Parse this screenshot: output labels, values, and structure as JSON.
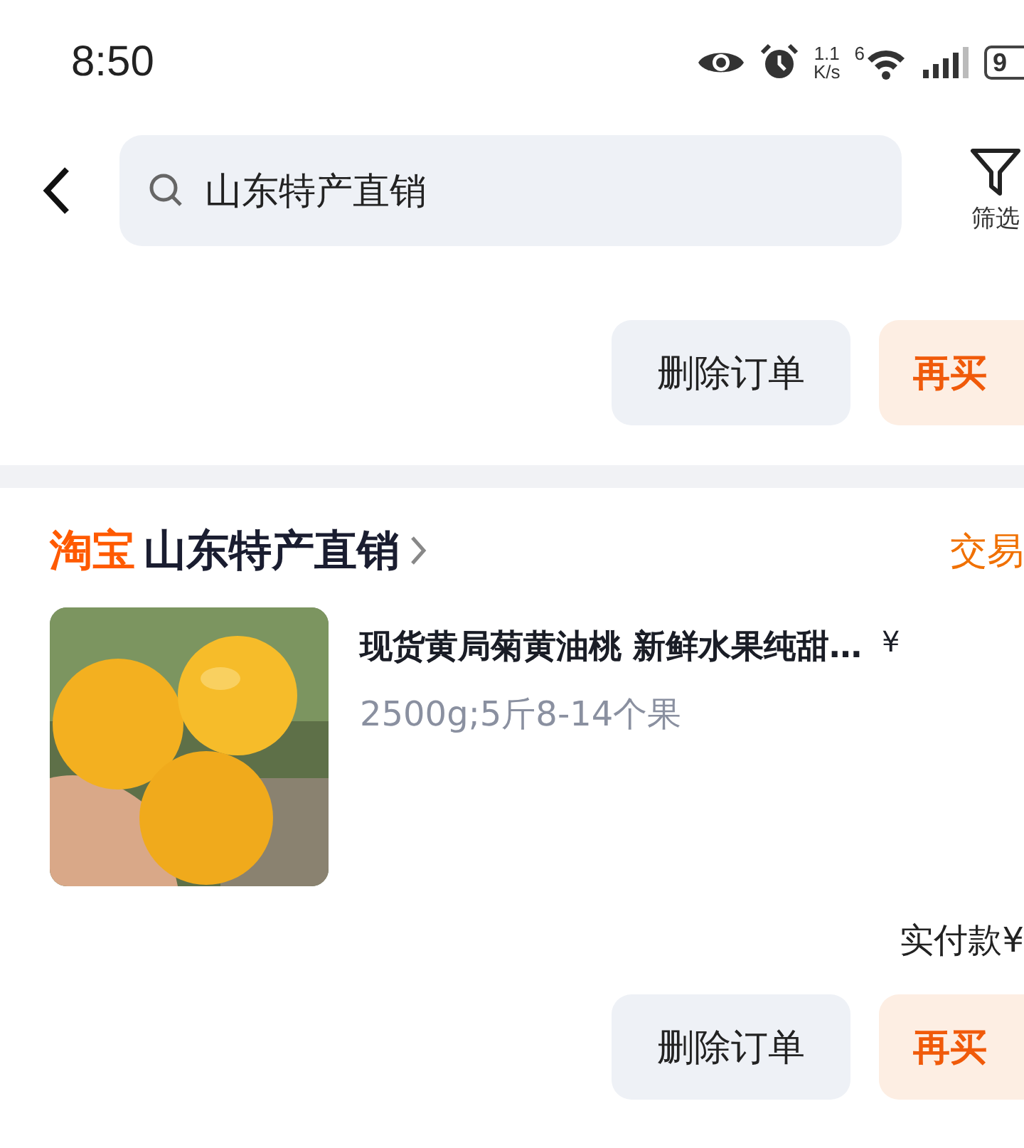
{
  "status_bar": {
    "time": "8:50",
    "speed_value": "1.1",
    "speed_unit": "K/s",
    "wifi_label": "6",
    "battery": "9"
  },
  "header": {
    "search": {
      "value": "山东特产直销"
    },
    "filter_label": "筛选"
  },
  "previous_order": {
    "buttons": [
      {
        "label": "删除订单",
        "kind": "secondary"
      },
      {
        "label": "再买",
        "kind": "primary"
      }
    ]
  },
  "order": {
    "platform": "淘宝",
    "shop": "山东特产直销",
    "status": "交易",
    "item": {
      "title": "现货黄局菊黄油桃 新鲜水果纯甜…",
      "price": "¥",
      "spec": "2500g;5斤8-14个果"
    },
    "paid_label": "实付款¥",
    "buttons": [
      {
        "label": "删除订单",
        "kind": "secondary"
      },
      {
        "label": "再买",
        "kind": "primary"
      }
    ]
  }
}
